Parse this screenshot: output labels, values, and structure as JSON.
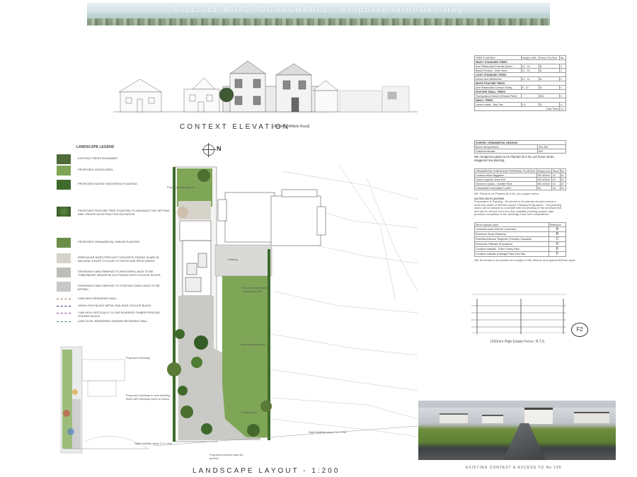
{
  "banner": {
    "title": "MILLISLE ROAD, DONAGHADEE  -  Proposed Infill Dwelling"
  },
  "context_elevation": {
    "title": "CONTEXT ELEVATION",
    "subtitle": "(Fronting Millisle Road)"
  },
  "landscape_layout": {
    "title": "LANDSCAPE LAYOUT -  1:200"
  },
  "existing_context": {
    "caption": "EXISTING CONTEXT & ACCESS TO No.195"
  },
  "fence": {
    "caption": "1200mm High Estate Fence. N.T.S.",
    "tag": "F2"
  },
  "north": {
    "label": "N"
  },
  "legend": {
    "title": "LANDSCAPE LEGEND",
    "items": [
      "EXISTING TREES BOUNDARY",
      "PROPOSED GRASS AREA",
      "PROPOSED NATIVE HEDGEROW PLANTING",
      "PROPOSED FEATURE TREE PLANTING TO ENHANCE THE SETTING AND CREATE AN ATTRACTIVE ELEVATION",
      "PROPOSED ORNAMENTAL SHRUB PLANTING",
      "IRREGULAR SIZED PRECAST CONCRETE PAVING SLABS IN NATURAL & BUFF COLOUR TO PATHS AND PATIO AREAS",
      "DRIVEWAYS AND PARKING TO NEW DWELLINGS TO BE TOBERMORE MANOR BLOCK PAVING WITH COLOUR SILVER",
      "DRIVEWAYS AND PARKING TO EXISTING DWELLINGS TO BE BITMAC",
      "2.8M HIGH RENDERED WALL",
      "1800m HIGH BLACK METAL RAILINGS COLOUR BLACK",
      "1.8M HIGH VERTICALLY CLOSE BOARDED TIMBER FENCING STAINED BLACK",
      "LOW LEVEL RENDERED GARDEN RETAINING WALL"
    ]
  },
  "tree_schedule": {
    "headers": [
      "TREE PLANTING",
      "Height | Girth",
      "Form | Pot Size",
      "No."
    ],
    "groups": [
      {
        "name": "HEAVY STANDARD TREES",
        "rows": [
          [
            "Acer Platanoides Emerald Queen",
            "12 - 14",
            "B",
            "2"
          ],
          [
            "Betula Pendula - Silver Birch",
            "12 - 14",
            "B",
            "2"
          ]
        ]
      },
      {
        "name": "LIGHT STANDARD TREES",
        "rows": [
          [
            "Sorbus Aria Whitebeam",
            "12 - 14",
            "B",
            "1"
          ]
        ]
      },
      {
        "name": "WHITE FEATURE TREES",
        "rows": [
          [
            "Acer Platanoides Crimson Sentry",
            "8 - 10",
            "B",
            "1"
          ]
        ]
      },
      {
        "name": "FEATURE SMALL TREES",
        "rows": [
          [
            "Trachycarpus fortunei (Chusan Palm)",
            "",
            "50L",
            "2"
          ]
        ]
      },
      {
        "name": "SMALL TREES",
        "rows": [
          [
            "Laurus nobilis - Bay Tree",
            "1.5",
            "B",
            "4"
          ]
        ]
      }
    ],
    "total_label": "Total Trees",
    "total_value": "14"
  },
  "hedging": {
    "title": "SCREEN / ORNAMENTAL HEDGING",
    "rows": [
      [
        "Buxus Sempervirens",
        "200-300"
      ],
      [
        "Griselinia littoralis",
        "600"
      ]
    ],
    "note": "NB: Hedgerow plants to be Planted @ 5 No. per linear metre, staggered row planting."
  },
  "shrubs": {
    "headers": [
      "ORNAMENTAL SHRUB AND PERENNIAL PLANTING",
      "Height (cm)",
      "Stock",
      "No."
    ],
    "rows": [
      [
        "Lonicera nitida 'Baggesen'",
        "300-400cm",
        "C2",
        "40"
      ],
      [
        "Cistus x cyprius 'Snow Fire'",
        "300-400cm",
        "C2",
        "25"
      ],
      [
        "Viburnum Opulus - Guelder Rose",
        "300-400cm",
        "C2",
        "20"
      ],
      [
        "Cotoneaster horizontalis 'Lucifer'",
        "Na",
        "C2",
        "15"
      ]
    ],
    "note": "NB: Plants to be Planted @ 5 No. per square metre.",
    "notes_title": "NOTES ON PLANTING",
    "notes": "Preparation & Planting - All shrubs to be planted should receive a minimum depth of 300mm topsoil. Planting Programme - The planting works will be phased to correlate with the phasing of the development and will be carried out in the first available planting season after practical completion of the dwellings have been established."
  },
  "climbers": {
    "headers": [
      "Shrub Species Used",
      "Reference"
    ],
    "rows": [
      [
        "Lavandula spica 'Hidcote' (Lavender)",
        "A"
      ],
      [
        "Phormium Tenax (Stokesia)",
        "B"
      ],
      [
        "Potentilla fruticosa 'Tangerine' (Shrubby Cinquefoil)",
        "C"
      ],
      [
        "Euonymus 'Hellcake' (Euonymus)",
        "D"
      ],
      [
        "Cordyline australis - Green Turkey Palm",
        "E"
      ],
      [
        "Cordyline australis (Cabbage Palm) Red Star",
        "F"
      ]
    ],
    "note": "NB: All shrubs to be planted at a height of 200-300mm and spaced 600mm apart."
  },
  "plan_labels": {
    "proposed_driveway": "Proposed driveway",
    "grass": "Amenity grass area",
    "access": "Proposed driveway to new dwelling finish with driveway bond to match",
    "visibility": "Sight visibility splay 2.4 x 70m",
    "visibility2": "Sight visibility splay 2.4 x 70m",
    "parking": "Parking",
    "turning": "Turning area",
    "rear_garden": "Proposed rear garden",
    "driveway_195": "Proposed driveway to existing No.195",
    "covered": "Proposed covered area for access"
  },
  "colors": {
    "grass": "#6f9a46",
    "paving": "#c9c9c5",
    "hedge": "#3f6b2c",
    "boundary": "#7a7a7a",
    "black_rail": "#1e2b66",
    "timber_fence": "#8a3a86",
    "retaining": "#2d8a4b"
  }
}
